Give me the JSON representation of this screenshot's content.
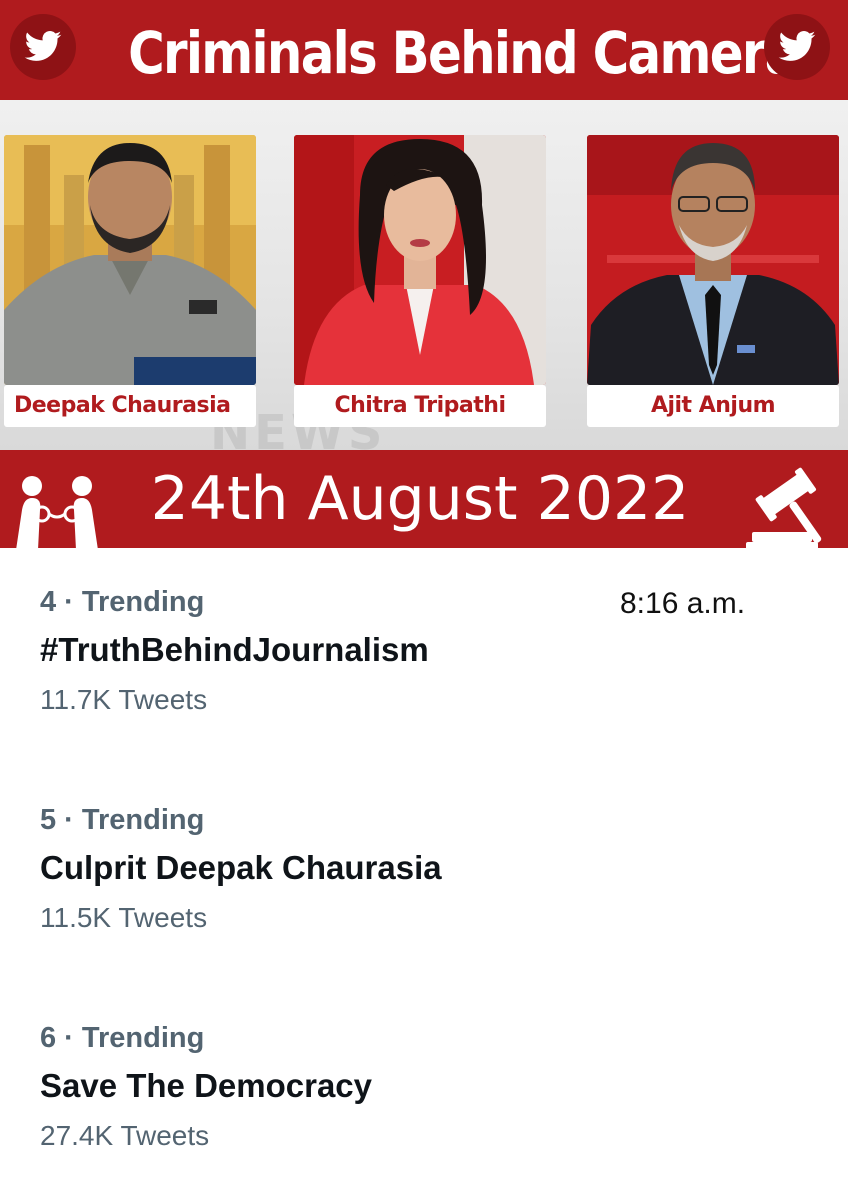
{
  "header": {
    "title": "Criminals Behind Camera",
    "left_icon": "twitter-bird-icon",
    "right_icon": "twitter-bird-icon",
    "accent_color": "#b01b1e"
  },
  "anchors": [
    {
      "name": "Deepak Chaurasia"
    },
    {
      "name": "Chitra Tripathi"
    },
    {
      "name": "Ajit Anjum"
    }
  ],
  "date_banner": {
    "date": "24th August 2022",
    "left_icon": "handcuffs-icon",
    "right_icon": "gavel-icon"
  },
  "timestamp": "8:16 a.m.",
  "trends": [
    {
      "meta": "4 · Trending",
      "title": "#TruthBehindJournalism",
      "count": "11.7K Tweets"
    },
    {
      "meta": "5 · Trending",
      "title": "Culprit Deepak Chaurasia",
      "count": "11.5K Tweets"
    },
    {
      "meta": "6 · Trending",
      "title": "Save The Democracy",
      "count": "27.4K Tweets"
    }
  ]
}
